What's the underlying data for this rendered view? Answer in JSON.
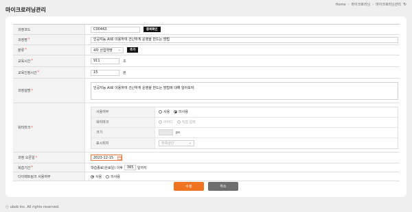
{
  "header": {
    "title": "마이크로러닝관리",
    "breadcrumb": [
      "Home",
      "마이크로러닝",
      "마이크로러닝관리"
    ]
  },
  "form": {
    "course_code": {
      "label": "과정코드",
      "value": "C00443",
      "button": "중복확인"
    },
    "course_name": {
      "label": "과정명",
      "value": "인공지능 AI로 이용하여 건난하게 운영을 만드는 방법"
    },
    "category": {
      "label": "분류",
      "value": "4차 산업혁명",
      "button": "추가"
    },
    "study_time": {
      "label": "교육시간",
      "value": "911",
      "unit": "초"
    },
    "recognized_time": {
      "label": "교육인정시간",
      "value": "15",
      "unit": "분"
    },
    "description": {
      "label": "과정설명",
      "value": "인공지능 AI로 이용하여 건난하게 운영을 만드는 방법에 대해 알아보자."
    },
    "watermark": {
      "label": "워터마크",
      "usage": {
        "label": "사용여부",
        "options": [
          "사용",
          "미사용"
        ],
        "selected": "미사용"
      },
      "type": {
        "label": "워터마크",
        "options": [
          "아이디",
          "직접 입력"
        ]
      },
      "size": {
        "label": "크기",
        "unit": "px"
      },
      "position": {
        "label": "표시위치",
        "value": "좌측상단"
      }
    },
    "open_date": {
      "label": "과정 오픈일",
      "value": "2023-12-15"
    },
    "review_period": {
      "label": "복습기간",
      "prefix": "학습종료(완료일) 이후",
      "value": "365",
      "suffix": "일까지"
    },
    "direct_link": {
      "label": "다이렉트링크 사용여부",
      "options": [
        "사용",
        "미사용"
      ],
      "selected": "사용"
    }
  },
  "actions": {
    "save": "수정",
    "cancel": "취소"
  },
  "footer": {
    "copyright": "ⓒ ubob Inc. All rights reserved."
  },
  "colors": {
    "accent": "#f07322",
    "cancel": "#6e6e6e",
    "background": "#efefef"
  }
}
